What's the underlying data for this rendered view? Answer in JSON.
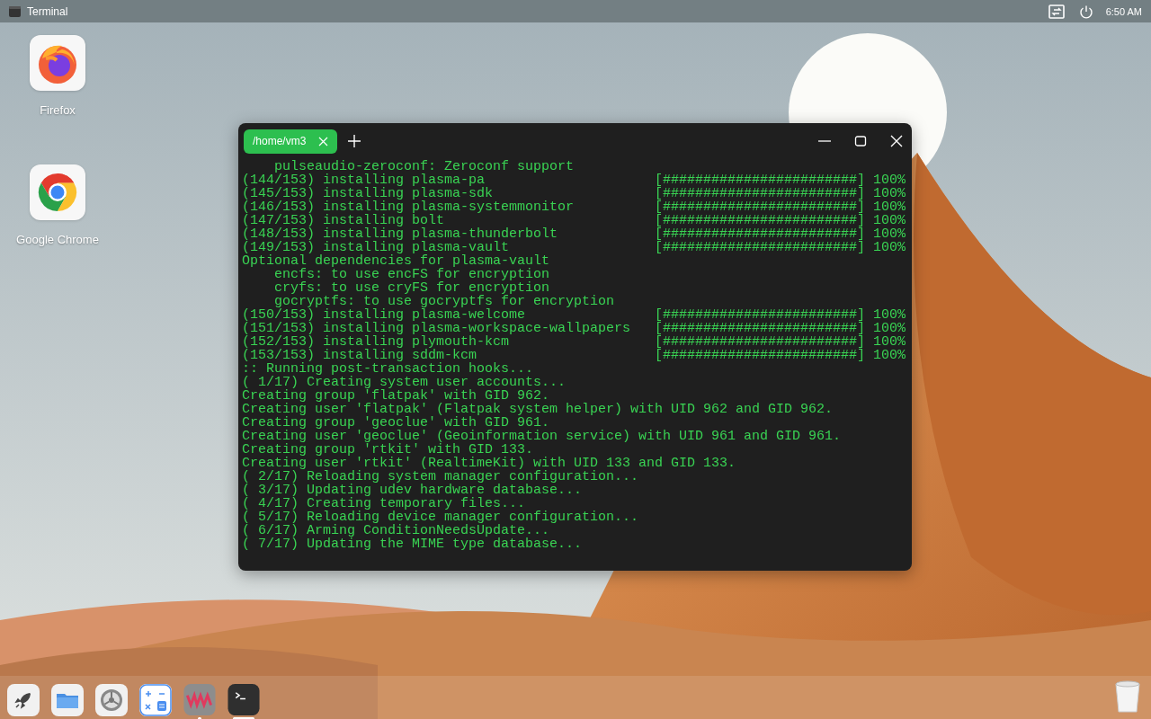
{
  "top_bar": {
    "app_title": "Terminal",
    "clock": "6:50 AM"
  },
  "desktop_icons": [
    {
      "kind": "firefox",
      "label": "Firefox"
    },
    {
      "kind": "chrome",
      "label": "Google Chrome"
    }
  ],
  "terminal": {
    "tabs": [
      {
        "title": "/home/vm3",
        "selected": true
      }
    ],
    "lines": [
      {
        "kind": "indented",
        "text": "pulseaudio-zeroconf: Zeroconf support"
      },
      {
        "kind": "progress",
        "text": "(144/153) installing plasma-pa",
        "bar": "[########################]",
        "percent": "100%"
      },
      {
        "kind": "progress",
        "text": "(145/153) installing plasma-sdk",
        "bar": "[########################]",
        "percent": "100%"
      },
      {
        "kind": "progress",
        "text": "(146/153) installing plasma-systemmonitor",
        "bar": "[########################]",
        "percent": "100%"
      },
      {
        "kind": "progress",
        "text": "(147/153) installing bolt",
        "bar": "[########################]",
        "percent": "100%"
      },
      {
        "kind": "progress",
        "text": "(148/153) installing plasma-thunderbolt",
        "bar": "[########################]",
        "percent": "100%"
      },
      {
        "kind": "progress",
        "text": "(149/153) installing plasma-vault",
        "bar": "[########################]",
        "percent": "100%"
      },
      {
        "kind": "plain",
        "text": "Optional dependencies for plasma-vault"
      },
      {
        "kind": "indented",
        "text": "encfs: to use encFS for encryption"
      },
      {
        "kind": "indented",
        "text": "cryfs: to use cryFS for encryption"
      },
      {
        "kind": "indented",
        "text": "gocryptfs: to use gocryptfs for encryption"
      },
      {
        "kind": "progress",
        "text": "(150/153) installing plasma-welcome",
        "bar": "[########################]",
        "percent": "100%"
      },
      {
        "kind": "progress",
        "text": "(151/153) installing plasma-workspace-wallpapers",
        "bar": "[########################]",
        "percent": "100%"
      },
      {
        "kind": "progress",
        "text": "(152/153) installing plymouth-kcm",
        "bar": "[########################]",
        "percent": "100%"
      },
      {
        "kind": "progress",
        "text": "(153/153) installing sddm-kcm",
        "bar": "[########################]",
        "percent": "100%"
      },
      {
        "kind": "plain",
        "text": ":: Running post-transaction hooks..."
      },
      {
        "kind": "plain",
        "text": "( 1/17) Creating system user accounts..."
      },
      {
        "kind": "plain",
        "text": "Creating group 'flatpak' with GID 962."
      },
      {
        "kind": "plain",
        "text": "Creating user 'flatpak' (Flatpak system helper) with UID 962 and GID 962."
      },
      {
        "kind": "plain",
        "text": "Creating group 'geoclue' with GID 961."
      },
      {
        "kind": "plain",
        "text": "Creating user 'geoclue' (Geoinformation service) with UID 961 and GID 961."
      },
      {
        "kind": "plain",
        "text": "Creating group 'rtkit' with GID 133."
      },
      {
        "kind": "plain",
        "text": "Creating user 'rtkit' (RealtimeKit) with UID 133 and GID 133."
      },
      {
        "kind": "plain",
        "text": "( 2/17) Reloading system manager configuration..."
      },
      {
        "kind": "plain",
        "text": "( 3/17) Updating udev hardware database..."
      },
      {
        "kind": "plain",
        "text": "( 4/17) Creating temporary files..."
      },
      {
        "kind": "plain",
        "text": "( 5/17) Reloading device manager configuration..."
      },
      {
        "kind": "plain",
        "text": "( 6/17) Arming ConditionNeedsUpdate..."
      },
      {
        "kind": "plain",
        "text": "( 7/17) Updating the MIME type database..."
      }
    ]
  },
  "dock": {
    "items": [
      {
        "kind": "launcher",
        "running": false
      },
      {
        "kind": "files",
        "running": false
      },
      {
        "kind": "settings",
        "running": false
      },
      {
        "kind": "calculator",
        "running": false
      },
      {
        "kind": "vm",
        "running": true
      },
      {
        "kind": "terminal",
        "running": true
      }
    ]
  }
}
